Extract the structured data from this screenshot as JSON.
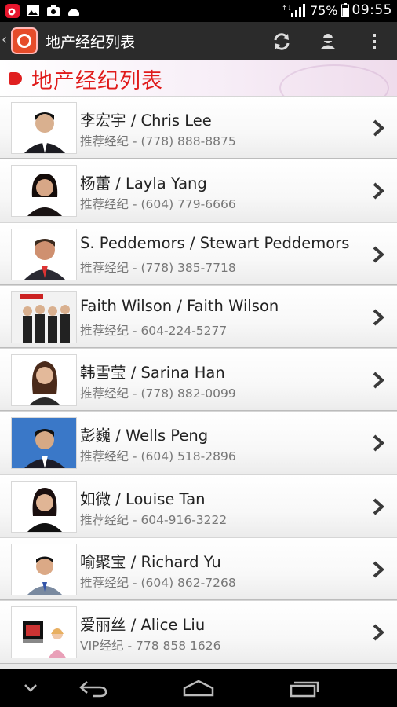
{
  "status_bar": {
    "battery": "75%",
    "time": "09:55",
    "icons": [
      "weibo-icon",
      "image-icon",
      "camera-icon",
      "android-icon",
      "signal-icon",
      "battery-icon"
    ]
  },
  "action_bar": {
    "title": "地产经纪列表",
    "icons": [
      "refresh-icon",
      "profile-icon",
      "overflow-menu-icon"
    ]
  },
  "header": {
    "title": "地产经纪列表",
    "accent": "#e01b1b"
  },
  "agents": [
    {
      "name": "李宏宇 / Chris Lee",
      "sub": "推荐经纪 - (778) 888-8875"
    },
    {
      "name": "杨蕾 / Layla Yang",
      "sub": "推荐经纪 - (604) 779-6666"
    },
    {
      "name": "S. Peddemors / Stewart Peddemors",
      "sub": "推荐经纪 - (778) 385-7718"
    },
    {
      "name": "Faith Wilson / Faith Wilson",
      "sub": "推荐经纪 - 604-224-5277"
    },
    {
      "name": "韩雪莹 / Sarina Han",
      "sub": "推荐经纪 - (778) 882-0099"
    },
    {
      "name": "彭巍 / Wells Peng",
      "sub": "推荐经纪 - (604) 518-2896"
    },
    {
      "name": "如微 / Louise Tan",
      "sub": "推荐经纪 - 604-916-3222"
    },
    {
      "name": "喻聚宝 / Richard Yu",
      "sub": "推荐经纪 - (604) 862-7268"
    },
    {
      "name": "爱丽丝 / Alice Liu",
      "sub": "VIP经纪 - 778 858 1626"
    }
  ],
  "nav_bar": {
    "icons": [
      "hide-keyboard-icon",
      "back-icon",
      "home-icon",
      "recents-icon"
    ]
  }
}
